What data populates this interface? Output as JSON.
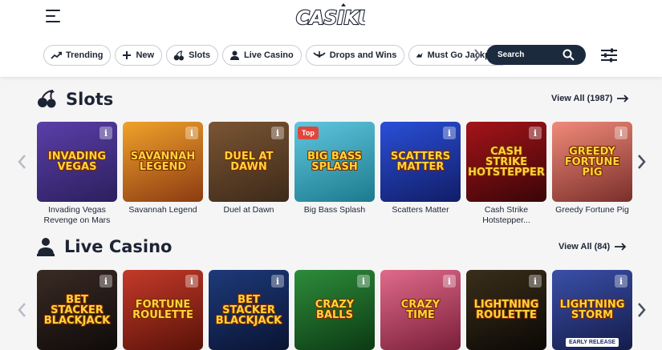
{
  "header": {
    "logo_text": "CASIKU"
  },
  "chips": [
    {
      "label": "Trending",
      "icon": "trending-icon"
    },
    {
      "label": "New",
      "icon": "plus-icon"
    },
    {
      "label": "Slots",
      "icon": "cherries-icon"
    },
    {
      "label": "Live Casino",
      "icon": "dealer-icon"
    },
    {
      "label": "Drops and Wins",
      "icon": "drops-icon"
    },
    {
      "label": "Must Go Jackpots",
      "icon": "jackpot-icon"
    }
  ],
  "search": {
    "placeholder": "Search"
  },
  "slots": {
    "title": "Slots",
    "view_all": "View All (1987)",
    "games": [
      {
        "label": "Invading Vegas Revenge on Mars",
        "art": "Invading Vegas",
        "bg": [
          "#5a3fa8",
          "#2c1f5e"
        ],
        "info": "i",
        "badge": ""
      },
      {
        "label": "Savannah Legend",
        "art": "Savannah Legend",
        "bg": [
          "#f0a22a",
          "#8c3b12"
        ],
        "info": "i",
        "badge": ""
      },
      {
        "label": "Duel at Dawn",
        "art": "Duel at Dawn",
        "bg": [
          "#7a5533",
          "#3d2a1a"
        ],
        "info": "i",
        "badge": ""
      },
      {
        "label": "Big Bass Splash",
        "art": "Big Bass Splash",
        "bg": [
          "#5fc7e0",
          "#1d7a8c"
        ],
        "info": "",
        "badge": "Top"
      },
      {
        "label": "Scatters Matter",
        "art": "Scatters Matter",
        "bg": [
          "#2a4fd8",
          "#111d66"
        ],
        "info": "i",
        "badge": ""
      },
      {
        "label": "Cash Strike Hotstepper...",
        "art": "Cash Strike Hotstepper",
        "bg": [
          "#a4141a",
          "#3a0507"
        ],
        "info": "i",
        "badge": ""
      },
      {
        "label": "Greedy Fortune Pig",
        "art": "Greedy Fortune Pig",
        "bg": [
          "#f08a7a",
          "#7a2f2a"
        ],
        "info": "i",
        "badge": ""
      }
    ]
  },
  "live_casino": {
    "title": "Live Casino",
    "view_all": "View All (84)",
    "games": [
      {
        "art": "Bet Stacker Blackjack",
        "bg": [
          "#3a2a24",
          "#0f0b0a"
        ],
        "info": "i"
      },
      {
        "art": "Fortune Roulette",
        "bg": [
          "#c43a2a",
          "#5a1208"
        ],
        "info": "i"
      },
      {
        "art": "Bet Stacker Blackjack",
        "bg": [
          "#1d3a7a",
          "#0a1433"
        ],
        "info": "i"
      },
      {
        "art": "Crazy Balls",
        "bg": [
          "#2d8c3a",
          "#0c3a14"
        ],
        "info": "i"
      },
      {
        "art": "Crazy Time",
        "bg": [
          "#e06a8a",
          "#7a1f3a"
        ],
        "info": "i"
      },
      {
        "art": "Lightning Roulette",
        "bg": [
          "#3a2e1a",
          "#0b0905"
        ],
        "info": "i"
      },
      {
        "art": "Lightning Storm",
        "bg": [
          "#3a4fa8",
          "#141c4a"
        ],
        "info": "i",
        "badge": "EARLY RELEASE"
      }
    ]
  }
}
